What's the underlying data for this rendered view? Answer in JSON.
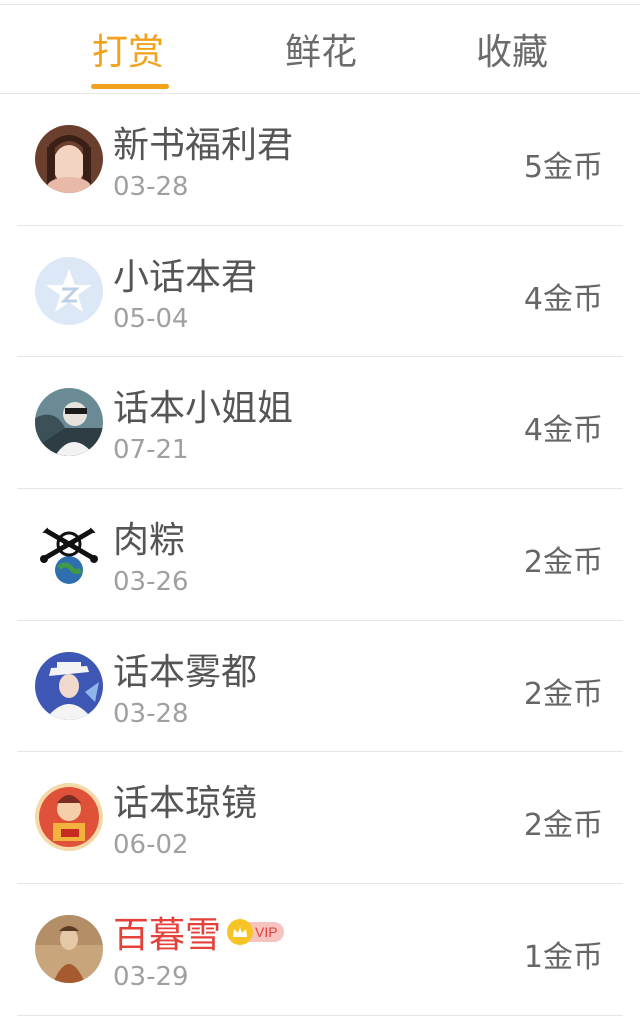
{
  "tabs": [
    {
      "label": "打赏",
      "active": true
    },
    {
      "label": "鲜花",
      "active": false
    },
    {
      "label": "收藏",
      "active": false
    }
  ],
  "colors": {
    "accent": "#f2a11a",
    "vip_name": "#e4413a",
    "divider": "#e6e6e6"
  },
  "rewards": [
    {
      "name": "新书福利君",
      "date": "03-28",
      "amount": "5金币",
      "avatar": "girl-photo-avatar"
    },
    {
      "name": "小话本君",
      "date": "05-04",
      "amount": "4金币",
      "avatar": "qq-star-avatar"
    },
    {
      "name": "话本小姐姐",
      "date": "07-21",
      "amount": "4金币",
      "avatar": "car-photo-avatar"
    },
    {
      "name": "肉粽",
      "date": "03-26",
      "amount": "2金币",
      "avatar": "skull-globe-avatar"
    },
    {
      "name": "话本雾都",
      "date": "03-28",
      "amount": "2金币",
      "avatar": "anime-avatar"
    },
    {
      "name": "话本琼镜",
      "date": "06-02",
      "amount": "2金币",
      "avatar": "red-cartoon-avatar"
    },
    {
      "name": "百暮雪",
      "date": "03-29",
      "amount": "1金币",
      "avatar": "painting-avatar",
      "vip": true,
      "vip_label": "VIP"
    }
  ]
}
